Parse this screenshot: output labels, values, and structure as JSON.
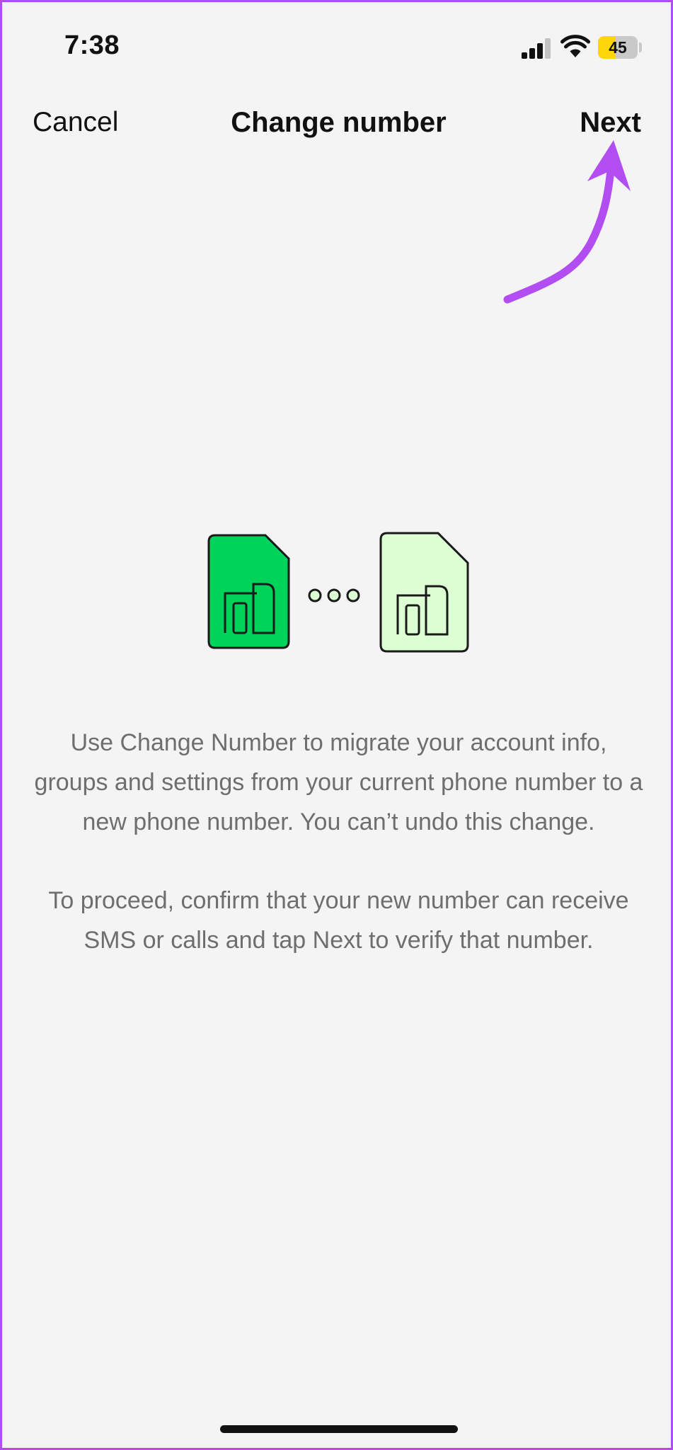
{
  "status_bar": {
    "time": "7:38",
    "battery_level": "45",
    "icons": [
      "signal-icon",
      "wifi-icon",
      "battery-icon"
    ]
  },
  "nav": {
    "cancel_label": "Cancel",
    "title": "Change number",
    "next_label": "Next"
  },
  "illustration": {
    "icons": [
      "sim-card-icon-current",
      "dots-icon",
      "sim-card-icon-new"
    ],
    "colors": {
      "current_sim": "#00d35a",
      "new_sim": "#dcffd4",
      "outline": "#1a1a1a"
    }
  },
  "body": {
    "paragraph_1": "Use Change Number to migrate your account info, groups and settings from your current phone number to a new phone number. You can’t undo this change.",
    "paragraph_2": "To proceed, confirm that your new number can receive SMS or calls and tap Next to verify that number."
  },
  "annotation": {
    "color": "#b24df2",
    "icon": "arrow-pointer-icon"
  },
  "colors": {
    "background": "#f4f4f4",
    "body_text": "#6e6e6e",
    "border": "#b24df2"
  }
}
